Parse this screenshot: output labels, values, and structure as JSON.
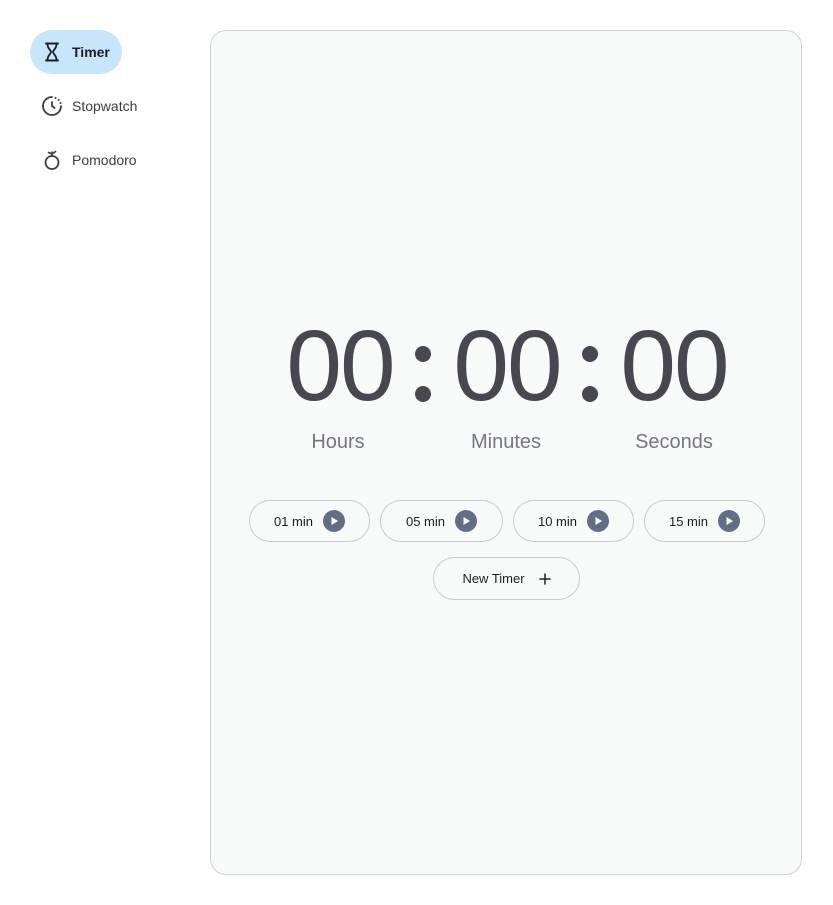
{
  "sidebar": {
    "items": [
      {
        "label": "Timer",
        "icon": "hourglass-icon",
        "active": true
      },
      {
        "label": "Stopwatch",
        "icon": "stopwatch-icon",
        "active": false
      },
      {
        "label": "Pomodoro",
        "icon": "pomodoro-icon",
        "active": false
      }
    ]
  },
  "clock": {
    "hours": "00",
    "minutes": "00",
    "seconds": "00",
    "hours_label": "Hours",
    "minutes_label": "Minutes",
    "seconds_label": "Seconds"
  },
  "presets": [
    {
      "label": "01 min",
      "icon": "play-icon"
    },
    {
      "label": "05 min",
      "icon": "play-icon"
    },
    {
      "label": "10 min",
      "icon": "play-icon"
    },
    {
      "label": "15 min",
      "icon": "play-icon"
    }
  ],
  "new_timer": {
    "label": "New Timer",
    "icon": "plus-icon"
  },
  "colors": {
    "active_nav_bg": "#c7e6fc",
    "digits": "#48464f",
    "play_button": "#626e85",
    "panel_bg": "#f8f9f9"
  }
}
